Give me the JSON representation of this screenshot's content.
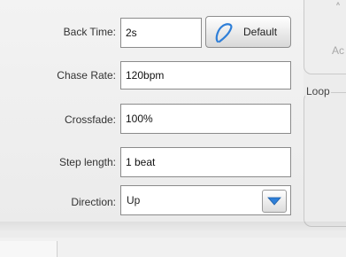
{
  "form": {
    "back_time": {
      "label": "Back Time:",
      "value": "2s"
    },
    "default_button": {
      "label": "Default",
      "icon": "swirl-icon"
    },
    "chase_rate": {
      "label": "Chase Rate:",
      "value": "120bpm"
    },
    "crossfade": {
      "label": "Crossfade:",
      "value": "100%"
    },
    "step_length": {
      "label": "Step length:",
      "value": "1 beat"
    },
    "direction": {
      "label": "Direction:",
      "value": "Up",
      "icon": "chevron-down-icon"
    }
  },
  "side_panel": {
    "clipped_label": "A",
    "partial_label": "Ac",
    "loop_group_title": "Loop"
  },
  "colors": {
    "accent": "#2f7fd8",
    "panel_bg": "#ececec"
  }
}
